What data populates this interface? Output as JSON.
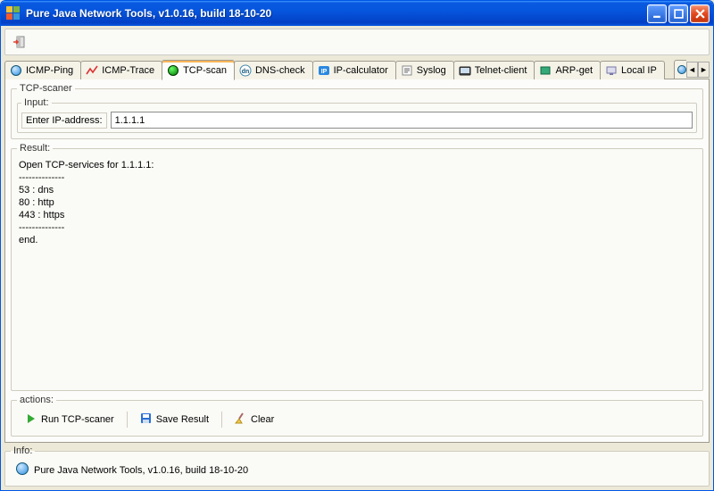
{
  "window": {
    "title": "Pure Java Network Tools,  v1.0.16, build 18-10-20"
  },
  "tabs": [
    {
      "label": "ICMP-Ping"
    },
    {
      "label": "ICMP-Trace"
    },
    {
      "label": "TCP-scan"
    },
    {
      "label": "DNS-check"
    },
    {
      "label": "IP-calculator"
    },
    {
      "label": "Syslog"
    },
    {
      "label": "Telnet-client"
    },
    {
      "label": "ARP-get"
    },
    {
      "label": "Local IP"
    }
  ],
  "panel": {
    "legend": "TCP-scaner",
    "input_legend": "Input:",
    "input_label": "Enter IP-address:",
    "ip_value": "1.1.1.1",
    "result_legend": "Result:",
    "result_text": "Open TCP-services for 1.1.1.1:\n--------------\n53 : dns\n80 : http\n443 : https\n--------------\nend."
  },
  "actions": {
    "legend": "actions:",
    "run": "Run TCP-scaner",
    "save": "Save Result",
    "clear": "Clear"
  },
  "info": {
    "legend": "Info:",
    "text": "Pure Java Network Tools,  v1.0.16, build 18-10-20"
  }
}
